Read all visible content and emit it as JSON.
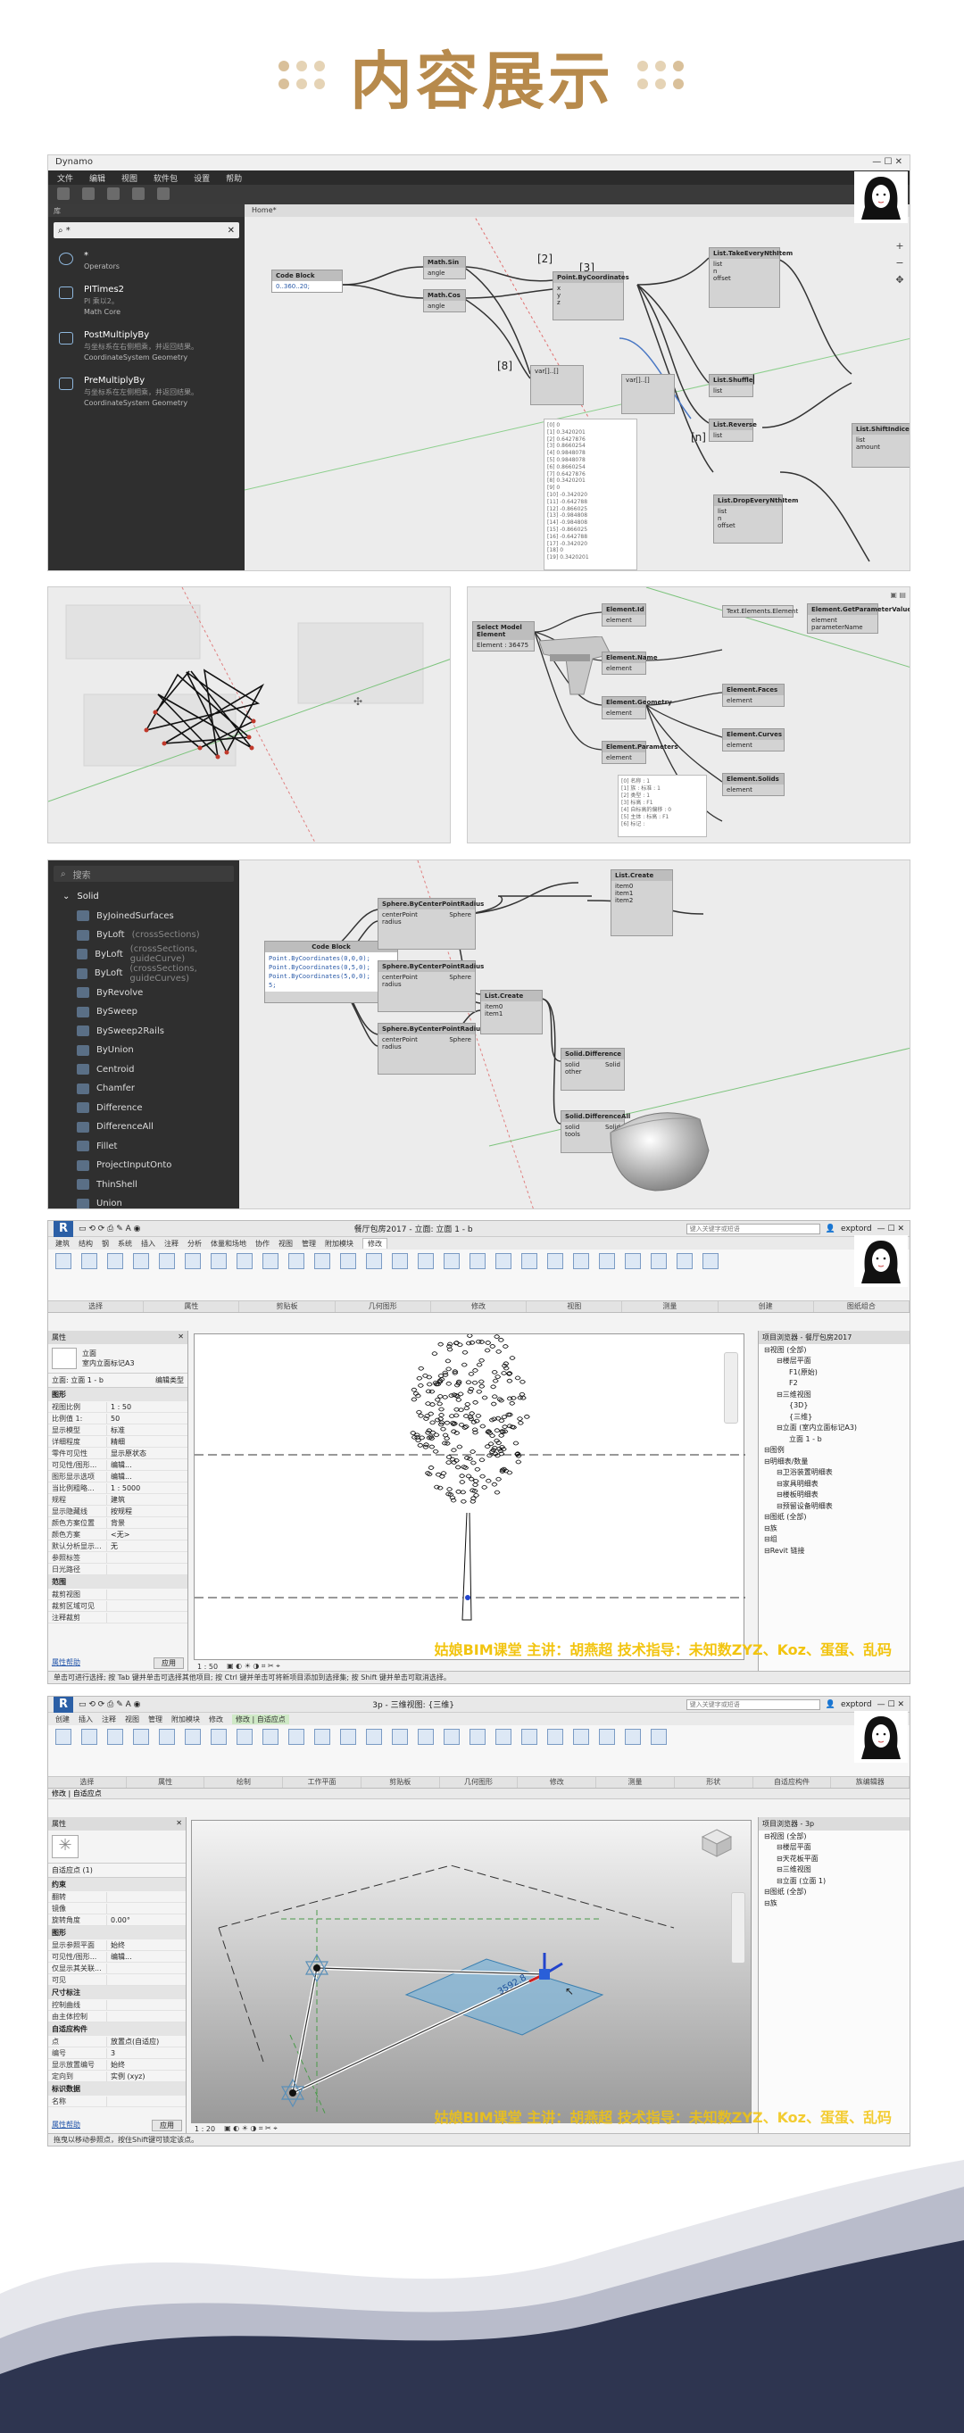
{
  "header": {
    "title": "内容展示"
  },
  "dynamo1": {
    "window_title": "Dynamo",
    "menu": [
      "文件",
      "编辑",
      "视图",
      "软件包",
      "设置",
      "帮助"
    ],
    "library_header": "库",
    "search_value": "*",
    "tab": "Home*",
    "library_items": [
      {
        "name": "*",
        "sub": "",
        "category": "Operators"
      },
      {
        "name": "PITimes2",
        "sub": "PI 乘以2。",
        "category": "Math Core"
      },
      {
        "name": "PostMultiplyBy",
        "sub": "与坐标系在右侧相乘，并返回结果。",
        "category": "CoordinateSystem Geometry"
      },
      {
        "name": "PreMultiplyBy",
        "sub": "与坐标系在左侧相乘，并返回结果。",
        "category": "CoordinateSystem Geometry"
      }
    ],
    "nodes": {
      "code_block": "Code Block",
      "code_text": "0..360..20;",
      "math_sin": "Math.Sin",
      "math_cos": "Math.Cos",
      "point": "Point.ByCoordinates",
      "take_every": "List.TakeEveryNthItem",
      "shuffle": "List.Shuffle",
      "reverse": "List.Reverse",
      "shift": "List.ShiftIndices",
      "drop_every": "List.DropEveryNthItem"
    }
  },
  "dynamo2": {
    "nodes": {
      "select": "Select Model Element",
      "element_id": "Element.Id",
      "param_by_name": "Element.GetParameterValueByName",
      "element_name": "Element.Name",
      "element_geom": "Element.Geometry",
      "element_params": "Element.Parameters",
      "text_id": "Text.Elements.Element",
      "element_faces": "Element.Faces",
      "element_curves": "Element.Curves",
      "element_solids": "Element.Solids"
    }
  },
  "dynamo3": {
    "search_placeholder": "搜索",
    "tree": [
      {
        "label": "Solid",
        "cat": true
      },
      {
        "label": "ByJoinedSurfaces"
      },
      {
        "label": "ByLoft",
        "extra": "(crossSections)"
      },
      {
        "label": "ByLoft",
        "extra": "(crossSections, guideCurve)"
      },
      {
        "label": "ByLoft",
        "extra": "(crossSections, guideCurves)"
      },
      {
        "label": "ByRevolve"
      },
      {
        "label": "BySweep"
      },
      {
        "label": "BySweep2Rails"
      },
      {
        "label": "ByUnion"
      },
      {
        "label": "Centroid"
      },
      {
        "label": "Chamfer"
      },
      {
        "label": "Difference"
      },
      {
        "label": "DifferenceAll"
      },
      {
        "label": "Fillet"
      },
      {
        "label": "ProjectInputOnto"
      },
      {
        "label": "ThinShell"
      },
      {
        "label": "Union"
      }
    ],
    "nodes": {
      "code_block": "Code Block",
      "code_lines": [
        "Point.ByCoordinates(0,0,0);",
        "Point.ByCoordinates(0,5,0);",
        "Point.ByCoordinates(5,0,0);",
        "5;"
      ],
      "sphere": "Sphere.ByCenterPointRadius",
      "sphere_ports": [
        "centerPoint",
        "radius"
      ],
      "sphere_out": "Sphere",
      "list_create": "List.Create",
      "solid_diff": "Solid.Difference",
      "solid_diff_all": "Solid.DifferenceAll",
      "solid_out": "Solid"
    }
  },
  "revit1": {
    "title": "餐厅包房2017 - 立面: 立面 1 - b",
    "search_placeholder": "键入关键字或短语",
    "user": "exptord",
    "tabs": [
      "建筑",
      "结构",
      "钢",
      "系统",
      "插入",
      "注释",
      "分析",
      "体量和场地",
      "协作",
      "视图",
      "管理",
      "附加模块",
      "修改"
    ],
    "active_tab": "修改",
    "props_header": "属性",
    "props_type": "立面",
    "props_type_sub": "室内立面标记A3",
    "props_selector": "立面: 立面 1 - b",
    "edit_type": "编辑类型",
    "props": [
      {
        "k": "视图比例",
        "v": "1 : 50"
      },
      {
        "k": "比例值 1:",
        "v": "50"
      },
      {
        "k": "显示模型",
        "v": "标准"
      },
      {
        "k": "详细程度",
        "v": "精细"
      },
      {
        "k": "零件可见性",
        "v": "显示原状态"
      },
      {
        "k": "可见性/图形...",
        "v": "编辑..."
      },
      {
        "k": "图形显示选项",
        "v": "编辑..."
      },
      {
        "k": "当比例粗略...",
        "v": "1 : 5000"
      },
      {
        "k": "规程",
        "v": "建筑"
      },
      {
        "k": "显示隐藏线",
        "v": "按规程"
      },
      {
        "k": "颜色方案位置",
        "v": "背景"
      },
      {
        "k": "颜色方案",
        "v": "<无>"
      },
      {
        "k": "默认分析显示...",
        "v": "无"
      },
      {
        "k": "参照标签",
        "v": ""
      },
      {
        "k": "日光路径",
        "v": ""
      }
    ],
    "props_section2": "范围",
    "props2": [
      {
        "k": "裁剪视图",
        "v": ""
      },
      {
        "k": "裁剪区域可见",
        "v": ""
      },
      {
        "k": "注释裁剪",
        "v": ""
      }
    ],
    "apply_label": "应用",
    "props_link": "属性帮助",
    "browser_header": "项目浏览器 - 餐厅包房2017",
    "browser": [
      {
        "t": "视图 (全部)",
        "l": 0
      },
      {
        "t": "楼层平面",
        "l": 1
      },
      {
        "t": "F1(原始)",
        "l": 2
      },
      {
        "t": "F2",
        "l": 2
      },
      {
        "t": "三维视图",
        "l": 1
      },
      {
        "t": "{3D}",
        "l": 2
      },
      {
        "t": "{三维}",
        "l": 2
      },
      {
        "t": "立面 (室内立面标记A3)",
        "l": 1
      },
      {
        "t": "立面 1 - b",
        "l": 2
      },
      {
        "t": "图例",
        "l": 0
      },
      {
        "t": "明细表/数量",
        "l": 0
      },
      {
        "t": "卫浴装置明细表",
        "l": 1
      },
      {
        "t": "家具明细表",
        "l": 1
      },
      {
        "t": "楼板明细表",
        "l": 1
      },
      {
        "t": "预留设备明细表",
        "l": 1
      },
      {
        "t": "图纸 (全部)",
        "l": 0
      },
      {
        "t": "族",
        "l": 0
      },
      {
        "t": "组",
        "l": 0
      },
      {
        "t": "Revit 链接",
        "l": 0
      }
    ],
    "view_scale": "1 : 50",
    "status": "单击可进行选择; 按 Tab 键并单击可选择其他项目; 按 Ctrl 键并单击可将新项目添加到选择集; 按 Shift 键并单击可取消选择。",
    "watermark": "姑娘BIM课堂  主讲：胡燕超  技术指导：未知数ZYZ、Koz、蛋蛋、乱码"
  },
  "revit2": {
    "title": "3p - 三维视图: {三维}",
    "search_placeholder": "键入关键字或短语",
    "user": "exptord",
    "tabs": [
      "创建",
      "插入",
      "注释",
      "视图",
      "管理",
      "附加模块",
      "修改",
      "修改 | 自适应点"
    ],
    "active_tab": "修改 | 自适应点",
    "sub_bar": "修改 | 自适应点",
    "props_header": "属性",
    "props_type": "自适应点 (1)",
    "props_section": "约束",
    "props": [
      {
        "k": "翻转",
        "v": ""
      },
      {
        "k": "镜像",
        "v": ""
      },
      {
        "k": "旋转角度",
        "v": "0.00°"
      }
    ],
    "props_section2": "图形",
    "props2": [
      {
        "k": "显示参照平面",
        "v": "始终"
      },
      {
        "k": "可见性/图形...",
        "v": "编辑..."
      },
      {
        "k": "仅显示其关联...",
        "v": ""
      },
      {
        "k": "可见",
        "v": ""
      }
    ],
    "props_section3": "尺寸标注",
    "props3": [
      {
        "k": "控制曲线",
        "v": ""
      },
      {
        "k": "由主体控制",
        "v": ""
      }
    ],
    "props_section4": "自适应构件",
    "props4": [
      {
        "k": "点",
        "v": "放置点(自适应)"
      },
      {
        "k": "编号",
        "v": "3"
      },
      {
        "k": "显示放置编号",
        "v": "始终"
      },
      {
        "k": "定向到",
        "v": "实例 (xyz)"
      }
    ],
    "props_section5": "标识数据",
    "props5": [
      {
        "k": "名称",
        "v": ""
      }
    ],
    "apply_label": "应用",
    "props_link": "属性帮助",
    "browser_header": "项目浏览器 - 3p",
    "browser": [
      {
        "t": "视图 (全部)",
        "l": 0
      },
      {
        "t": "楼层平面",
        "l": 1
      },
      {
        "t": "天花板平面",
        "l": 1
      },
      {
        "t": "三维视图",
        "l": 1
      },
      {
        "t": "立面 (立面 1)",
        "l": 1
      },
      {
        "t": "图纸 (全部)",
        "l": 0
      },
      {
        "t": "族",
        "l": 0
      }
    ],
    "view_scale": "1 : 20",
    "status": "拖曳以移动参照点，按住Shift键可锁定该点。",
    "watermark": "姑娘BIM课堂  主讲：胡燕超  技术指导：未知数ZYZ、Koz、蛋蛋、乱码"
  },
  "colors": {
    "title": "#b78a4c",
    "wave_dark": "#2e3550",
    "watermark": "#f2c40f",
    "dynamo_dark": "#2f2f2f"
  }
}
